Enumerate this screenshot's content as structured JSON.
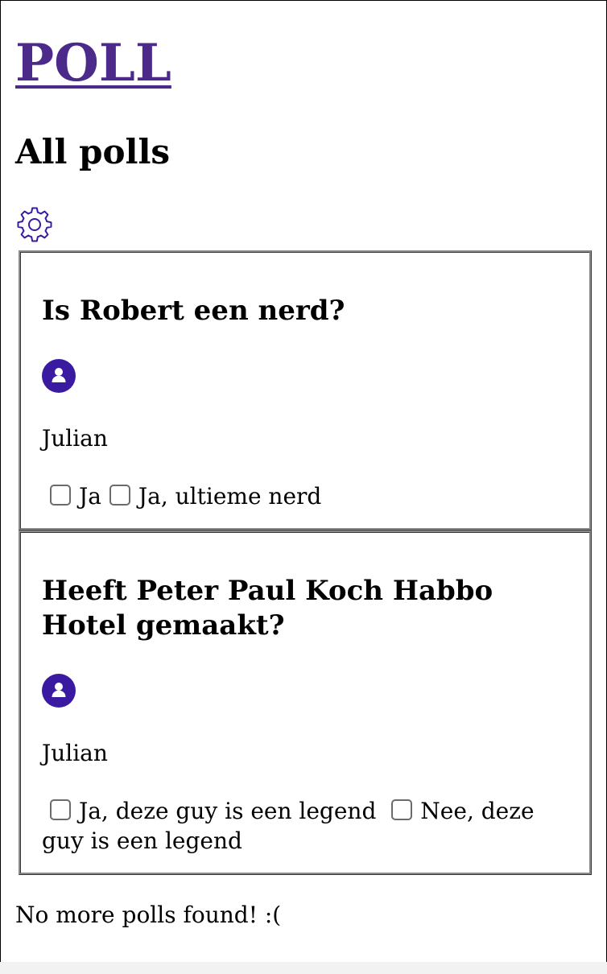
{
  "header": {
    "brand": "POLL",
    "title": "All polls",
    "settings_icon": "gear-icon",
    "accent_color": "#4b2a8a"
  },
  "polls": [
    {
      "question": "Is Robert een nerd?",
      "avatar_icon": "user-icon",
      "author": "Julian",
      "options": [
        {
          "label": "Ja",
          "checked": false
        },
        {
          "label": "Ja, ultieme nerd",
          "checked": false
        }
      ]
    },
    {
      "question": "Heeft Peter Paul Koch Habbo Hotel gemaakt?",
      "avatar_icon": "user-icon",
      "author": "Julian",
      "options": [
        {
          "label": "Ja, deze guy is een legend",
          "checked": false
        },
        {
          "label": "Nee, deze guy is een legend",
          "checked": false
        }
      ]
    }
  ],
  "footer": {
    "message": "No more polls found! :("
  }
}
